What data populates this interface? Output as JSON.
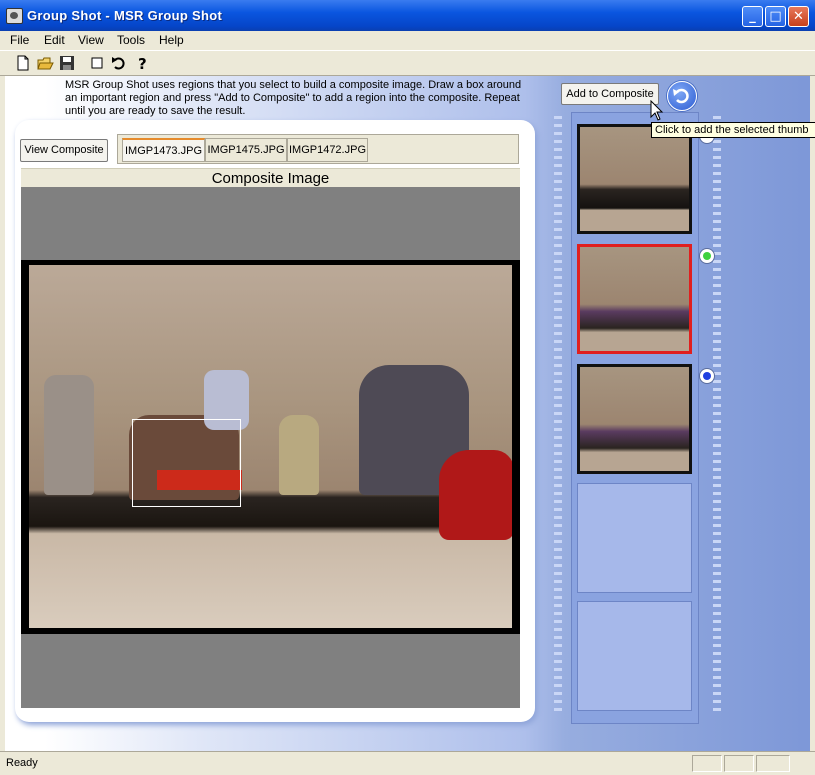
{
  "window": {
    "title": "Group Shot - MSR Group Shot",
    "min_icon": "minimize-icon",
    "max_icon": "maximize-icon",
    "close_icon": "close-icon"
  },
  "menu": {
    "file": "File",
    "edit": "Edit",
    "view": "View",
    "tools": "Tools",
    "help": "Help"
  },
  "toolbar": {
    "icons": [
      "new-document-icon",
      "open-folder-icon",
      "save-icon",
      "select-rectangle-icon",
      "undo-icon",
      "help-icon"
    ]
  },
  "instructions": {
    "text": "MSR Group Shot uses regions that you select to build a composite image.  Draw a box around an important region and press \"Add to Composite\" to add a region into the composite. Repeat until you are ready to save the result."
  },
  "buttons": {
    "view_composite": "View Composite",
    "add_to_composite": "Add to Composite"
  },
  "tabs": [
    {
      "label": "IMGP1473.JPG",
      "active": true
    },
    {
      "label": "IMGP1475.JPG",
      "active": false
    },
    {
      "label": "IMGP1472.JPG",
      "active": false
    }
  ],
  "composite": {
    "header": "Composite Image"
  },
  "tooltip": {
    "text": "Click to add the selected thumb"
  },
  "thumbnails": [
    {
      "state": "normal",
      "radio": "none"
    },
    {
      "state": "selected",
      "radio": "green"
    },
    {
      "state": "normal",
      "radio": "blue"
    },
    {
      "state": "empty"
    },
    {
      "state": "empty"
    }
  ],
  "colors": {
    "selected_border": "#e01f1f",
    "radio_green": "#3ed13e",
    "radio_blue": "#1f3fe0",
    "accent_blue": "#0a56e0"
  },
  "status": {
    "text": "Ready"
  }
}
